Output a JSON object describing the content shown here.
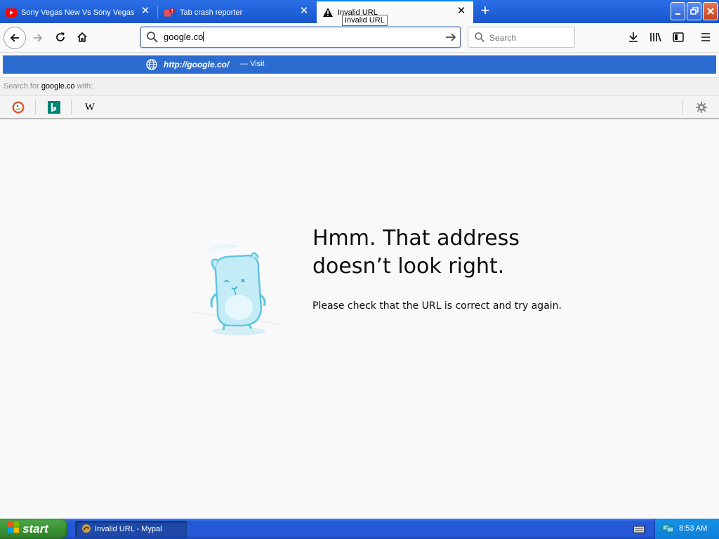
{
  "tabs": [
    {
      "title": "Sony Vegas New Vs Sony Vegas Ol",
      "favicon": "youtube-icon",
      "active": false
    },
    {
      "title": "Tab crash reporter",
      "favicon": "crash-reporter-icon",
      "active": false
    },
    {
      "title": "Invalid URL",
      "favicon": "warning-icon",
      "active": true
    }
  ],
  "tooltip": "Invalid URL",
  "navbar": {
    "url_value": "google.co",
    "search_placeholder": "Search"
  },
  "autocomplete": {
    "url": "http://google.co/",
    "separator": "—",
    "action": "Visit",
    "search_with_prefix": "Search for",
    "search_with_term": "google.co",
    "search_with_suffix": "with:",
    "engines": [
      "duckduckgo-icon",
      "bing-icon",
      "wikipedia-icon"
    ],
    "wikipedia_glyph": "W"
  },
  "error": {
    "title": "Hmm. That address doesn’t look right.",
    "message": "Please check that the URL is correct and try again."
  },
  "taskbar": {
    "start_label": "start",
    "task_label": "Invalid URL - Mypal",
    "clock": "8:53 AM"
  },
  "colors": {
    "accent": "#0a84ff",
    "autocomplete_highlight": "#2c6cd0",
    "titlebar": "#1d5fd6",
    "start_green": "#3a9434"
  }
}
